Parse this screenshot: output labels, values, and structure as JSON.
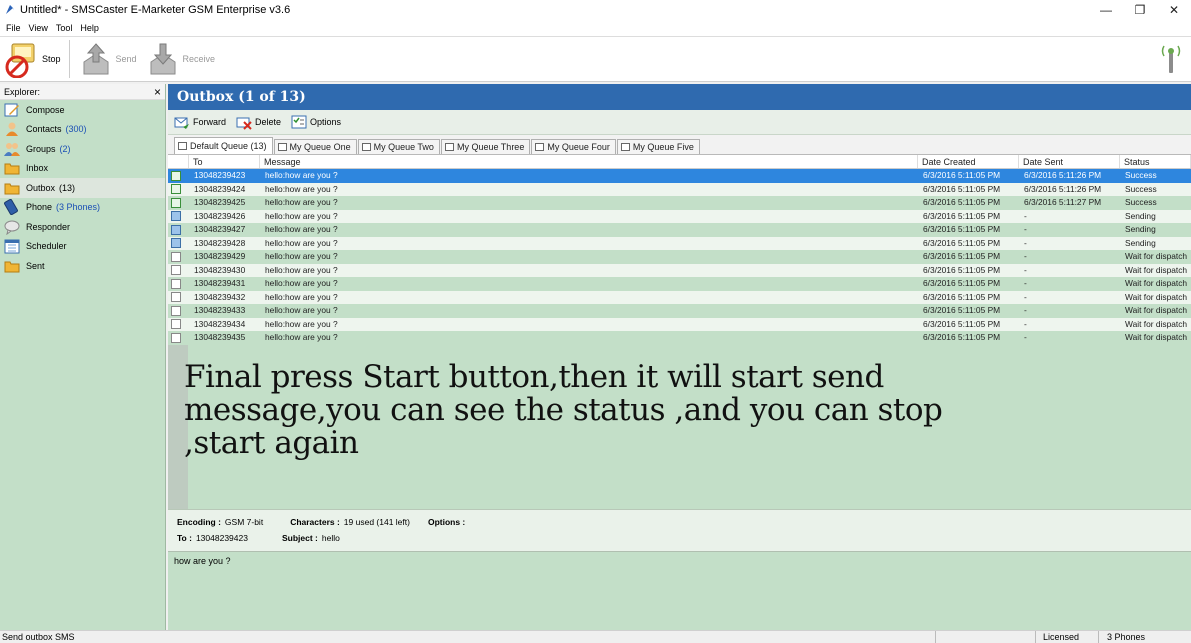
{
  "window": {
    "title": "Untitled* - SMSCaster E-Marketer GSM Enterprise v3.6",
    "controls": [
      "—",
      "❐",
      "✕"
    ]
  },
  "menu": [
    "File",
    "View",
    "Tool",
    "Help"
  ],
  "toolbar": {
    "stop_label": "Stop",
    "send_label": "Send",
    "receive_label": "Receive"
  },
  "explorer": {
    "header": "Explorer:",
    "close": "×",
    "items": [
      {
        "label": "Compose",
        "count": ""
      },
      {
        "label": "Contacts",
        "count": "(300)"
      },
      {
        "label": "Groups",
        "count": "(2)"
      },
      {
        "label": "Inbox",
        "count": ""
      },
      {
        "label": "Outbox",
        "count": "(13)"
      },
      {
        "label": "Phone",
        "count": "(3 Phones)"
      },
      {
        "label": "Responder",
        "count": ""
      },
      {
        "label": "Scheduler",
        "count": ""
      },
      {
        "label": "Sent",
        "count": ""
      }
    ]
  },
  "outbox": {
    "title": "Outbox (1 of 13)",
    "actions": {
      "forward": "Forward",
      "delete": "Delete",
      "options": "Options"
    },
    "tabs": [
      "Default Queue (13)",
      "My Queue One",
      "My Queue Two",
      "My Queue Three",
      "My Queue Four",
      "My Queue Five"
    ],
    "columns": [
      "To",
      "Message",
      "Date Created",
      "Date Sent",
      "Status"
    ],
    "rows": [
      {
        "to": "13048239423",
        "message": "hello:how are you ?",
        "created": "6/3/2016 5:11:05 PM",
        "sent": "6/3/2016 5:11:26 PM",
        "status": "Success",
        "state": "ok"
      },
      {
        "to": "13048239424",
        "message": "hello:how are you ?",
        "created": "6/3/2016 5:11:05 PM",
        "sent": "6/3/2016 5:11:26 PM",
        "status": "Success",
        "state": "ok"
      },
      {
        "to": "13048239425",
        "message": "hello:how are you ?",
        "created": "6/3/2016 5:11:05 PM",
        "sent": "6/3/2016 5:11:27 PM",
        "status": "Success",
        "state": "ok"
      },
      {
        "to": "13048239426",
        "message": "hello:how are you ?",
        "created": "6/3/2016 5:11:05 PM",
        "sent": "-",
        "status": "Sending",
        "state": "snd"
      },
      {
        "to": "13048239427",
        "message": "hello:how are you ?",
        "created": "6/3/2016 5:11:05 PM",
        "sent": "-",
        "status": "Sending",
        "state": "snd"
      },
      {
        "to": "13048239428",
        "message": "hello:how are you ?",
        "created": "6/3/2016 5:11:05 PM",
        "sent": "-",
        "status": "Sending",
        "state": "snd"
      },
      {
        "to": "13048239429",
        "message": "hello:how are you ?",
        "created": "6/3/2016 5:11:05 PM",
        "sent": "-",
        "status": "Wait for dispatch",
        "state": "wait"
      },
      {
        "to": "13048239430",
        "message": "hello:how are you ?",
        "created": "6/3/2016 5:11:05 PM",
        "sent": "-",
        "status": "Wait for dispatch",
        "state": "wait"
      },
      {
        "to": "13048239431",
        "message": "hello:how are you ?",
        "created": "6/3/2016 5:11:05 PM",
        "sent": "-",
        "status": "Wait for dispatch",
        "state": "wait"
      },
      {
        "to": "13048239432",
        "message": "hello:how are you ?",
        "created": "6/3/2016 5:11:05 PM",
        "sent": "-",
        "status": "Wait for dispatch",
        "state": "wait"
      },
      {
        "to": "13048239433",
        "message": "hello:how are you ?",
        "created": "6/3/2016 5:11:05 PM",
        "sent": "-",
        "status": "Wait for dispatch",
        "state": "wait"
      },
      {
        "to": "13048239434",
        "message": "hello:how are you ?",
        "created": "6/3/2016 5:11:05 PM",
        "sent": "-",
        "status": "Wait for dispatch",
        "state": "wait"
      },
      {
        "to": "13048239435",
        "message": "hello:how are you ?",
        "created": "6/3/2016 5:11:05 PM",
        "sent": "-",
        "status": "Wait for dispatch",
        "state": "wait"
      }
    ],
    "selected_row": 0
  },
  "caption": "Final press Start button,then it will start send message,you can see the status ,and you can stop ,start again",
  "details": {
    "encoding_label": "Encoding :",
    "encoding_value": "GSM 7-bit",
    "characters_label": "Characters :",
    "characters_value": "19 used (141 left)",
    "options_label": "Options :",
    "to_label": "To :",
    "to_value": "13048239423",
    "subject_label": "Subject :",
    "subject_value": "hello",
    "body": "how are you ?"
  },
  "statusbar": {
    "left": "Send outbox SMS",
    "licensed": "Licensed",
    "phones": "3 Phones"
  }
}
